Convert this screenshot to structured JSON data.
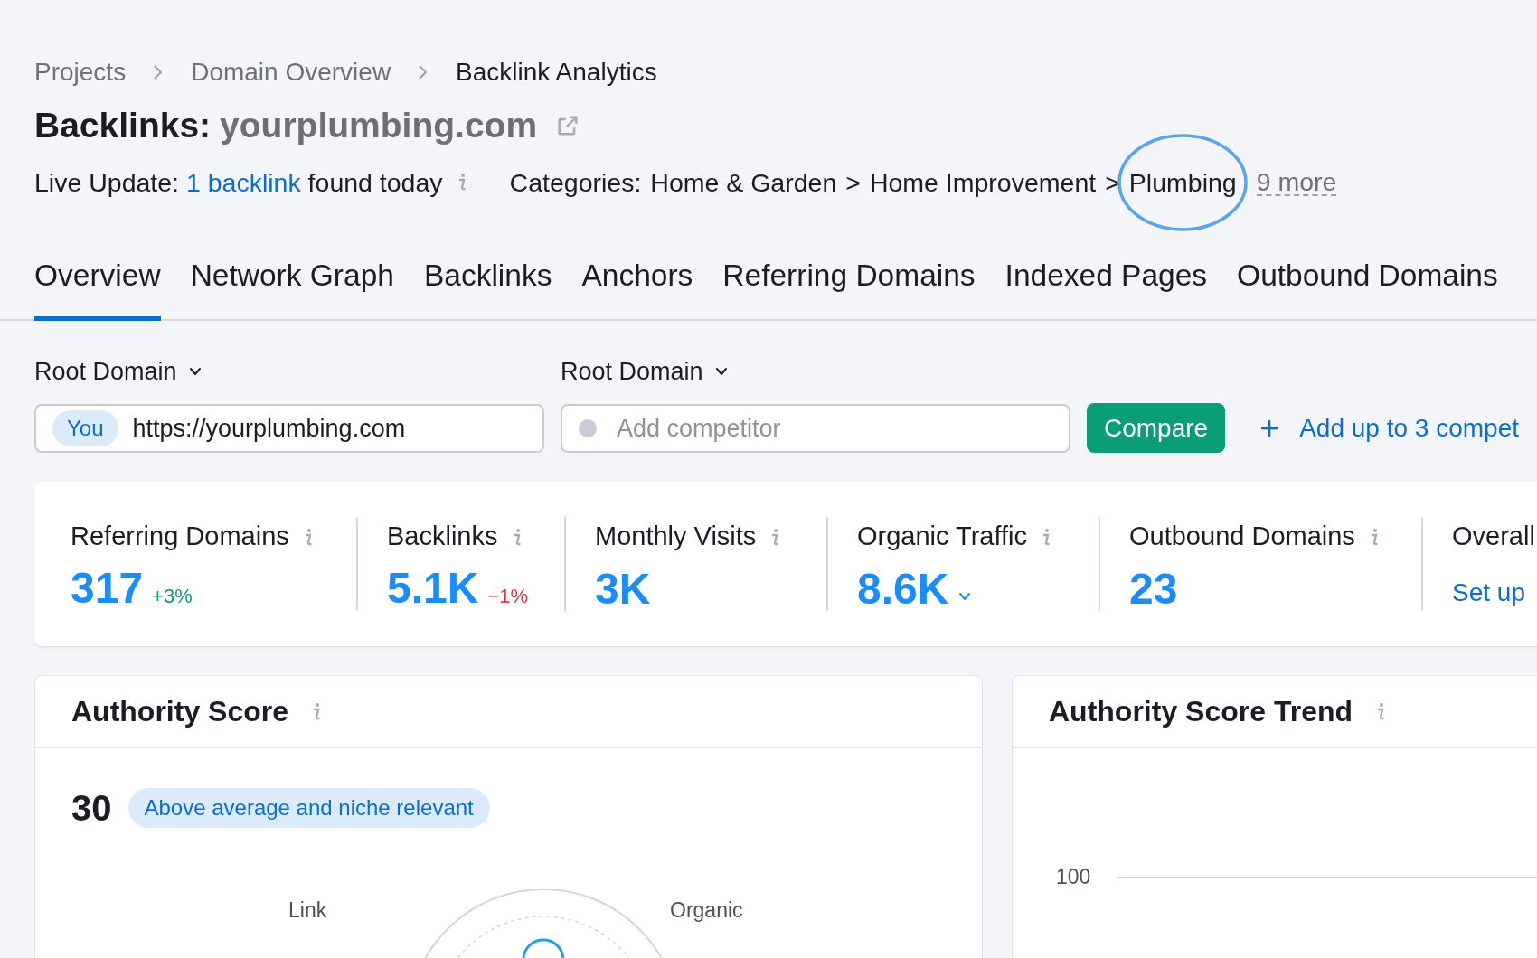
{
  "breadcrumbs": [
    {
      "label": "Projects",
      "selected": false
    },
    {
      "label": "Domain Overview",
      "selected": false
    },
    {
      "label": "Backlink Analytics",
      "selected": true
    }
  ],
  "title": {
    "prefix": "Backlinks:",
    "domain": "yourplumbing.com"
  },
  "live_update": {
    "label": "Live Update:",
    "link": "1 backlink",
    "suffix": "found today"
  },
  "categories": {
    "label": "Categories:",
    "path": [
      "Home & Garden",
      "Home Improvement",
      "Plumbing"
    ],
    "separator": ">",
    "more": "9 more"
  },
  "tabs": [
    {
      "label": "Overview",
      "selected": true
    },
    {
      "label": "Network Graph",
      "selected": false
    },
    {
      "label": "Backlinks",
      "selected": false
    },
    {
      "label": "Anchors",
      "selected": false
    },
    {
      "label": "Referring Domains",
      "selected": false
    },
    {
      "label": "Indexed Pages",
      "selected": false
    },
    {
      "label": "Outbound Domains",
      "selected": false
    }
  ],
  "compare": {
    "left": {
      "scope": "Root Domain",
      "badge": "You",
      "value": "https://yourplumbing.com"
    },
    "right": {
      "scope": "Root Domain",
      "placeholder": "Add competitor"
    },
    "button": "Compare",
    "add_link": "Add up to 3 compet"
  },
  "metrics": [
    {
      "label": "Referring Domains",
      "kind": "number",
      "value": "317",
      "change": "+3%",
      "color": "#0a9e6f",
      "dropdown": false
    },
    {
      "label": "Backlinks",
      "kind": "number",
      "value": "5.1K",
      "change": "−1%",
      "color": "#e5353e",
      "dropdown": false
    },
    {
      "label": "Monthly Visits",
      "kind": "number",
      "value": "3K",
      "dropdown": false
    },
    {
      "label": "Organic Traffic",
      "kind": "number",
      "value": "8.6K",
      "dropdown": true
    },
    {
      "label": "Outbound Domains",
      "kind": "number",
      "value": "23",
      "dropdown": false
    },
    {
      "label": "Overall",
      "kind": "link",
      "value": "Set up",
      "dropdown": false
    }
  ],
  "authority_score": {
    "title": "Authority Score",
    "score": "30",
    "badge": "Above average and niche relevant",
    "axis_labels": [
      "Link",
      "Organic"
    ]
  },
  "authority_trend": {
    "title": "Authority Score Trend",
    "y_tick": "100"
  }
}
